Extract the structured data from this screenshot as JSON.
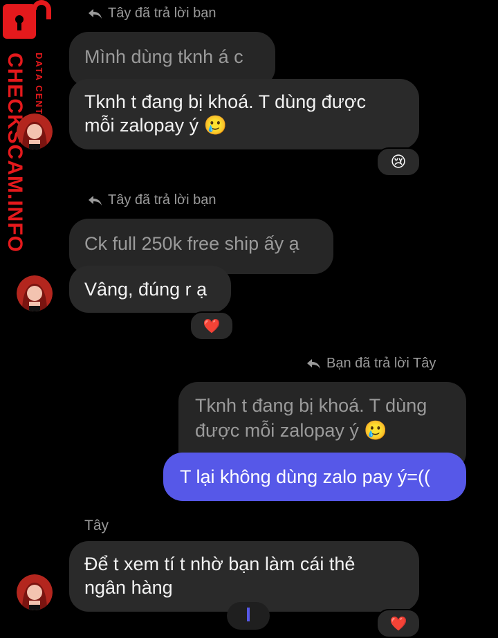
{
  "watermark": {
    "brand": "CHECKSCAM.INFO",
    "sub": "DATA CENTER"
  },
  "thread": {
    "reply_notes": {
      "tay_replied_1": "Tây đã trả lời bạn",
      "tay_replied_2": "Tây đã trả lời bạn",
      "you_replied": "Bạn đã trả lời Tây"
    },
    "messages": [
      {
        "quoted": "Mình dùng tknh á c",
        "text_line1": "Tknh t đang bị khoá. T dùng được",
        "text_line2": "mỗi zalopay ý",
        "emoji": "🥲",
        "reaction": "😢"
      },
      {
        "quoted": "Ck full 250k free ship ấy ạ",
        "text": "Vâng, đúng r ạ",
        "reaction": "❤️"
      },
      {
        "quoted_line1": "Tknh t đang bị khoá. T dùng",
        "quoted_line2": "được mỗi zalopay ý",
        "quoted_emoji": "🥲",
        "text": "T lại không dùng zalo pay ý=(("
      },
      {
        "sender": "Tây",
        "text_line1": "Để t xem tí t nhờ bạn làm cái thẻ",
        "text_line2": "ngân hàng",
        "reaction": "❤️"
      }
    ]
  },
  "colors": {
    "background": "#000000",
    "incoming_bubble": "#2a2a2a",
    "outgoing_bubble": "#5658e8",
    "watermark": "#e4191c"
  }
}
